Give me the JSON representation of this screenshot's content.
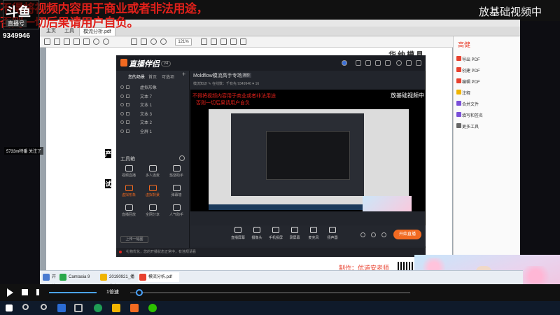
{
  "overlay": {
    "warning_line1": "不得将视频内容用于商业或者非法用途，",
    "warning_line2": "否则一切后果请用户自负。",
    "logo_text": "斗鱼",
    "logo_sub": "直播号",
    "room_id": "9349946",
    "top_right_title": "放基础视频中",
    "chat_user": "5733m特番 关注了",
    "side_label_1": "产",
    "side_label_2": "试"
  },
  "pdf_reader": {
    "tabs": [
      "主页",
      "工具",
      "模流分析.pdf"
    ],
    "zoom": "121%",
    "page_heading": "华纳模具",
    "search_label": "高健",
    "sidebar_items": [
      {
        "label": "导出 PDF",
        "color": "#e8412f"
      },
      {
        "label": "创建 PDF",
        "color": "#e8412f"
      },
      {
        "label": "编辑 PDF",
        "color": "#e8412f"
      },
      {
        "label": "注释",
        "color": "#f0b400"
      },
      {
        "label": "合并文件",
        "color": "#7a4fd8"
      },
      {
        "label": "填写和签名",
        "color": "#7a4fd8"
      },
      {
        "label": "更多工具",
        "color": "#666666"
      }
    ],
    "footer_note": "制作：优道安老师"
  },
  "streaming_app": {
    "name": "直播伴侣",
    "version": "v4",
    "source_tabs": [
      "您的场景",
      "首页",
      "可选项"
    ],
    "sources": [
      "虚拟形象",
      "文本 7",
      "文本 1",
      "文本 3",
      "文本 2",
      "全屏 1"
    ],
    "tools_title": "工具箱",
    "tools": [
      {
        "label": "视频直播",
        "active": false
      },
      {
        "label": "多人连麦",
        "active": false
      },
      {
        "label": "悠悠助手",
        "active": false
      },
      {
        "label": "虚拟形象",
        "active": true
      },
      {
        "label": "虚拟背景",
        "active": true
      },
      {
        "label": "弹幕墙",
        "active": false
      },
      {
        "label": "直播回放",
        "active": false
      },
      {
        "label": "全网分享",
        "active": false
      },
      {
        "label": "人气助手",
        "active": false
      }
    ],
    "more_label": "上传一幅图",
    "status_text": "礼物优化，您的开播状态正常中，有违规请看",
    "stream_title": "Moldflow模流高手专场",
    "stream_category": "摄影",
    "stream_meta": "模流知识 ✎   在线数：千有先   9349946   ♥ 16",
    "preview_red_1": "不得将视频内容用于商业或者非法用途",
    "preview_red_2": "否则一切后果请用户自负",
    "preview_title": "放基础视频中",
    "controls": [
      "直播屏幕",
      "摄像头",
      "手机投屏",
      "录屏幕",
      "麦克风",
      "扬声器"
    ],
    "start_live": "开始直播"
  },
  "desktop_taskbar": [
    {
      "label": "开始",
      "color": "#4a7bd0"
    },
    {
      "label": "Camtasia 9",
      "color": "#2aa84a"
    },
    {
      "label": "20190921_播放台",
      "color": "#f0b400"
    },
    {
      "label": "模流分析.pdf",
      "color": "#e8412f"
    }
  ],
  "player": {
    "speed_label": "1倍速",
    "volume_level": 1.0,
    "seek_position": 0.02
  }
}
